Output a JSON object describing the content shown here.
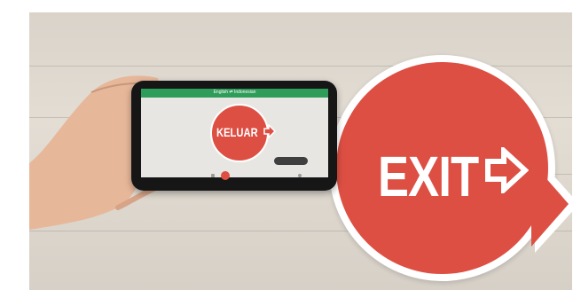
{
  "scene": {
    "sign_text": "EXIT",
    "sign_color": "#dd4f43"
  },
  "phone": {
    "top_bar_text": "English ⇄ Indonesian",
    "translated_text": "KELUAR",
    "accent_color": "#2e9d5a"
  },
  "icons": [
    "arrow-right-icon",
    "shutter-icon"
  ]
}
